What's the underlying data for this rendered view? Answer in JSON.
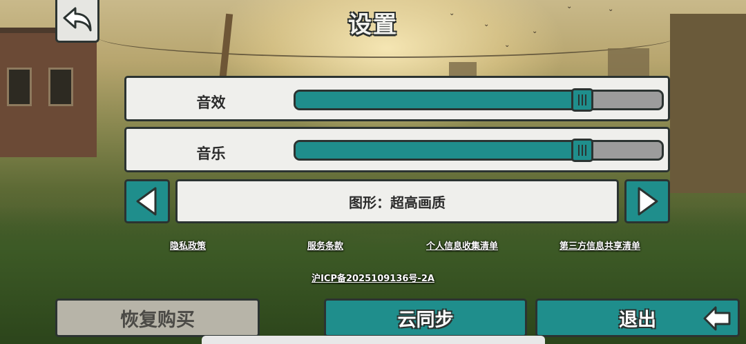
{
  "title": "设置",
  "settings": {
    "sound_effects": {
      "label": "音效",
      "level": 0.78
    },
    "music": {
      "label": "音乐",
      "level": 0.78
    },
    "graphics": {
      "label": "图形：超高画质"
    }
  },
  "links": {
    "privacy": "隐私政策",
    "terms": "服务条款",
    "personal_info": "个人信息收集清单",
    "third_party": "第三方信息共享清单",
    "icp": "沪ICP备2025109136号-2A"
  },
  "buttons": {
    "restore": "恢复购买",
    "cloud_sync": "云同步",
    "exit": "退出"
  },
  "icons": {
    "back": "back-arrow-icon",
    "left": "triangle-left-icon",
    "right": "triangle-right-icon",
    "exit": "exit-arrow-icon"
  },
  "colors": {
    "accent": "#1f8e8c",
    "panel": "#efefec",
    "outline": "#2b3331",
    "disabled": "#b7b4a8"
  }
}
